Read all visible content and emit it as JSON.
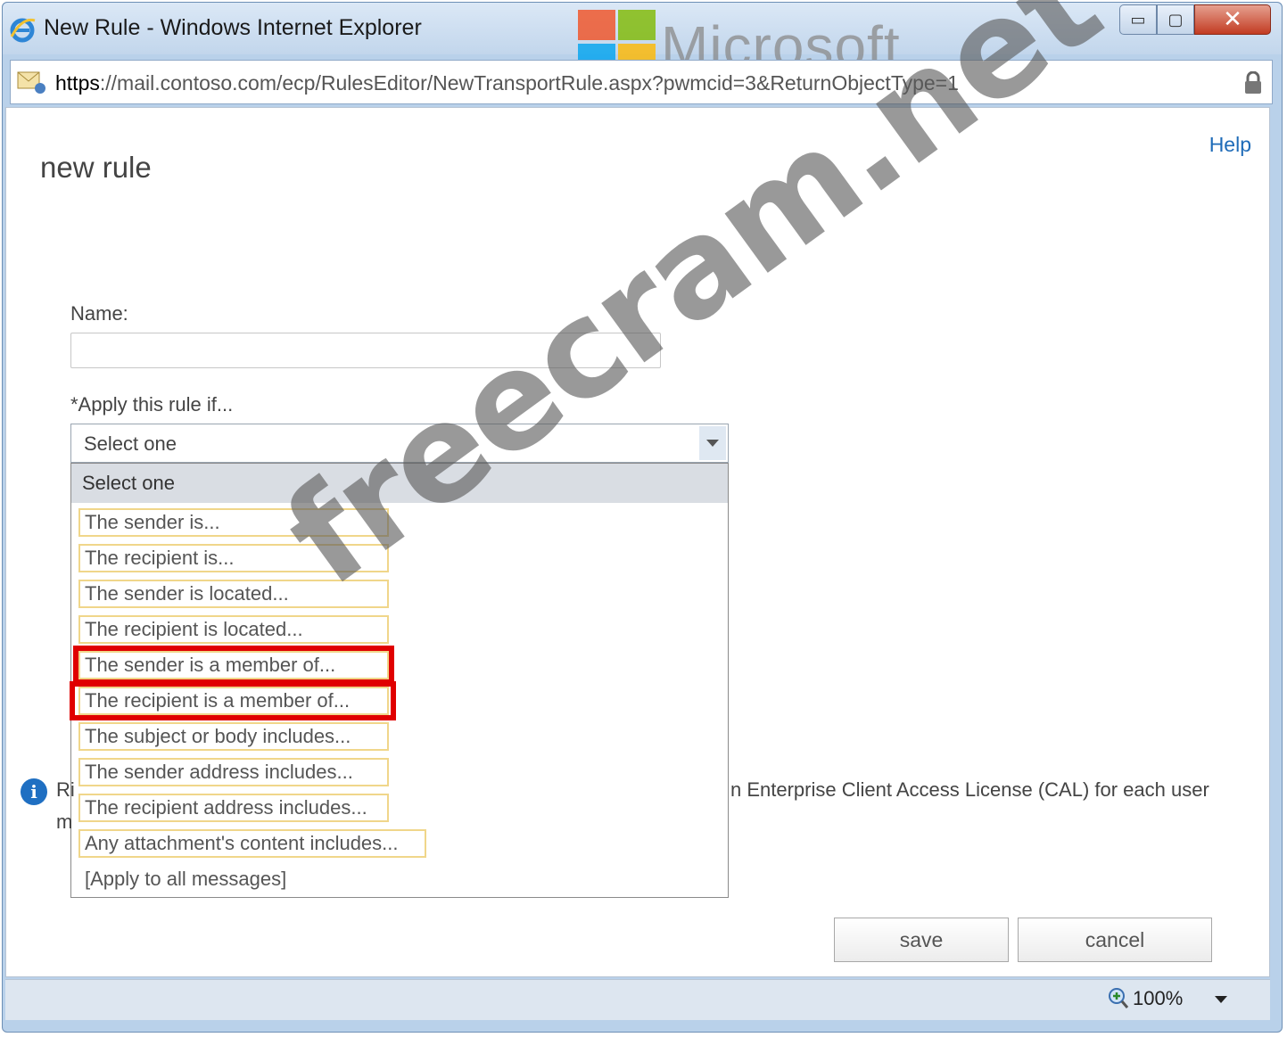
{
  "window": {
    "title": "New Rule - Windows Internet Explorer",
    "controls": {
      "minimize": "▭",
      "maximize": "▢",
      "close": "✕"
    }
  },
  "address": {
    "protocol": "https",
    "rest": "://mail.contoso.com/ecp/RulesEditor/NewTransportRule.aspx?pwmcid=3&ReturnObjectType=1"
  },
  "overlays": {
    "brand": "Microsoft",
    "watermark": "freecram.net"
  },
  "page": {
    "help": "Help",
    "title": "new rule",
    "name_label": "Name:",
    "name_value": "",
    "apply_label": "*Apply this rule if...",
    "select_value": "Select one"
  },
  "dropdown": {
    "header": "Select one",
    "items": [
      "The sender is...",
      "The recipient is...",
      "The sender is located...",
      "The recipient is located...",
      "The sender is a member of...",
      "The recipient is a member of...",
      "The subject or body includes...",
      "The sender address includes...",
      "The recipient address includes...",
      "Any attachment's content includes...",
      "[Apply to all messages]"
    ],
    "highlighted": [
      "The sender is a member of...",
      "The recipient is a member of..."
    ]
  },
  "info": {
    "fragment_line1": "Ri",
    "fragment_line2": "m",
    "text": "n Enterprise Client Access License (CAL) for each user"
  },
  "buttons": {
    "save": "save",
    "cancel": "cancel"
  },
  "status": {
    "zoom": "100%"
  },
  "colors": {
    "highlight": "#e00000",
    "item_border": "#f0d68a",
    "link": "#1e6bb8",
    "info_icon": "#1f6fc2",
    "close_button": "#c23b22"
  }
}
